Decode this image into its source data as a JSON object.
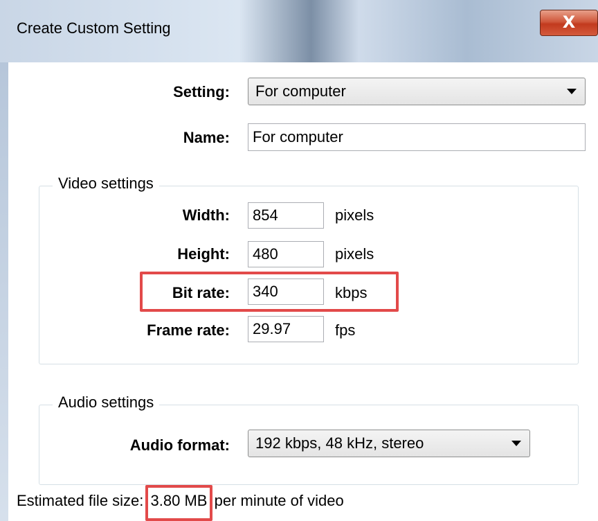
{
  "window": {
    "title": "Create Custom Setting",
    "close_glyph": "X"
  },
  "setting": {
    "label": "Setting:",
    "value": "For computer"
  },
  "name": {
    "label": "Name:",
    "value": "For computer"
  },
  "video": {
    "title": "Video settings",
    "width": {
      "label": "Width:",
      "value": "854",
      "unit": "pixels"
    },
    "height": {
      "label": "Height:",
      "value": "480",
      "unit": "pixels"
    },
    "bitrate": {
      "label": "Bit rate:",
      "value": "340",
      "unit": "kbps"
    },
    "framerate": {
      "label": "Frame rate:",
      "value": "29.97",
      "unit": "fps"
    }
  },
  "audio": {
    "title": "Audio settings",
    "format": {
      "label": "Audio format:",
      "value": "192 kbps, 48 kHz, stereo"
    }
  },
  "estimate": {
    "prefix": "Estimated file size:",
    "size": "3.80 MB",
    "suffix": "per minute of video"
  },
  "colors": {
    "highlight": "#e24a4a",
    "close_button": "#c23a1e"
  }
}
